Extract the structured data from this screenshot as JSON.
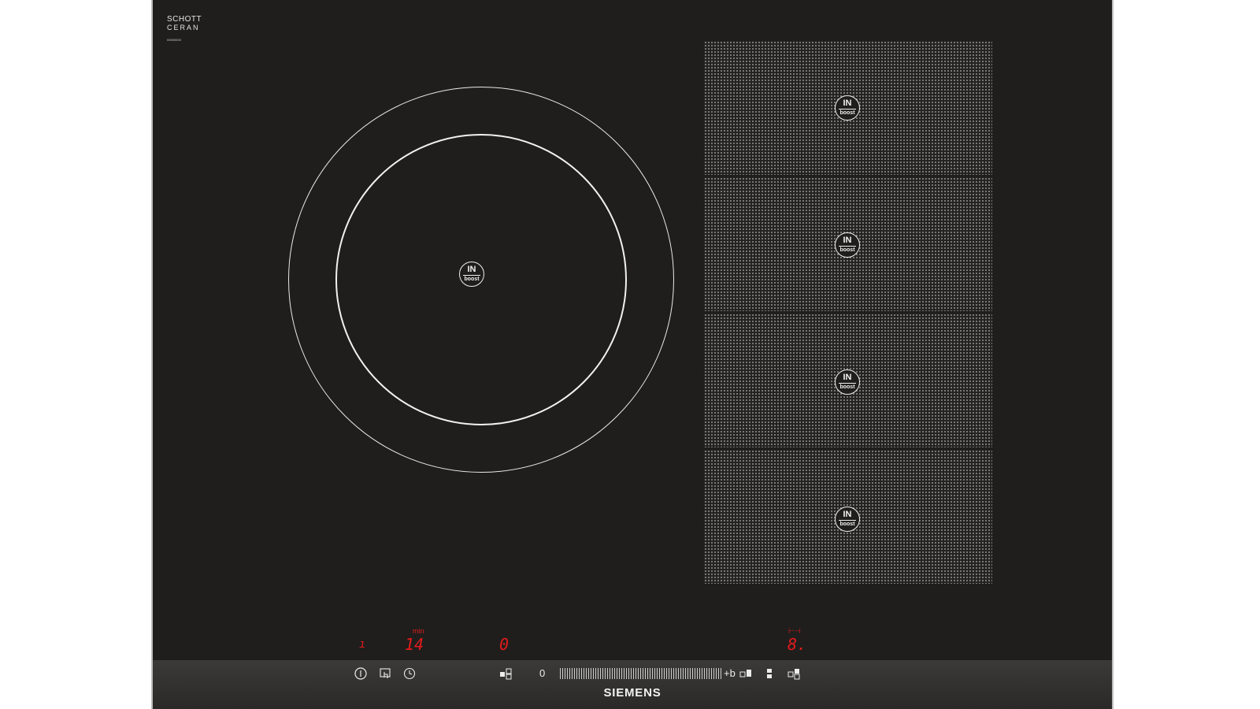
{
  "brand_top": {
    "line1": "SCHOTT",
    "line2": "CERAN",
    "serial": "00000000"
  },
  "zones": {
    "round": {
      "icon": "in-boost-icon",
      "label_top": "IN",
      "label_bottom": "boost"
    },
    "flex": [
      {
        "label_top": "IN",
        "label_bottom": "boost"
      },
      {
        "label_top": "IN",
        "label_bottom": "boost"
      },
      {
        "label_top": "IN",
        "label_bottom": "boost"
      },
      {
        "label_top": "IN",
        "label_bottom": "boost"
      }
    ]
  },
  "displays": {
    "indicator": "ı",
    "timer_unit": "min",
    "timer_value": "14",
    "zone_level": "0",
    "right_symbol": "⊢⊣",
    "right_level": "8."
  },
  "controls": {
    "power_icon": "power-icon",
    "wipe_protect_icon": "hand-protect-icon",
    "timer_icon": "clock-icon",
    "zone_select_left_icon": "zone-select-icon",
    "slider_min": "0",
    "slider_max": "+b",
    "zone_select_right_icons": [
      "flex-zone-left-icon",
      "flex-zone-middle-icon",
      "flex-zone-right-icon"
    ]
  },
  "brand_bottom": "SIEMENS",
  "colors": {
    "glass": "#1f1e1d",
    "display_red": "#e21b1b",
    "print": "#f0f0f0"
  }
}
